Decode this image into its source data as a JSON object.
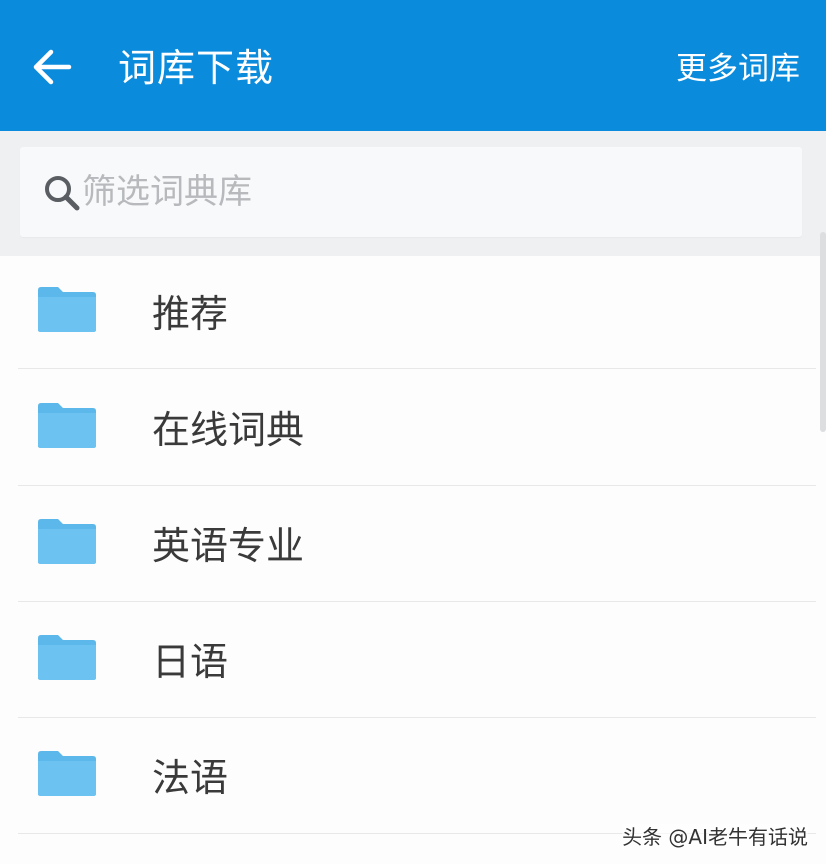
{
  "header": {
    "title": "词库下载",
    "more_label": "更多词库",
    "back_icon": "arrow-left-icon",
    "background": "#0b8bdc"
  },
  "search": {
    "placeholder": "筛选词典库",
    "value": "",
    "icon": "search-icon"
  },
  "list": {
    "items": [
      {
        "label": "推荐",
        "icon": "folder-icon"
      },
      {
        "label": "在线词典",
        "icon": "folder-icon"
      },
      {
        "label": "英语专业",
        "icon": "folder-icon"
      },
      {
        "label": "日语",
        "icon": "folder-icon"
      },
      {
        "label": "法语",
        "icon": "folder-icon"
      }
    ]
  },
  "watermark": {
    "text": "头条 @AI老牛有话说"
  }
}
